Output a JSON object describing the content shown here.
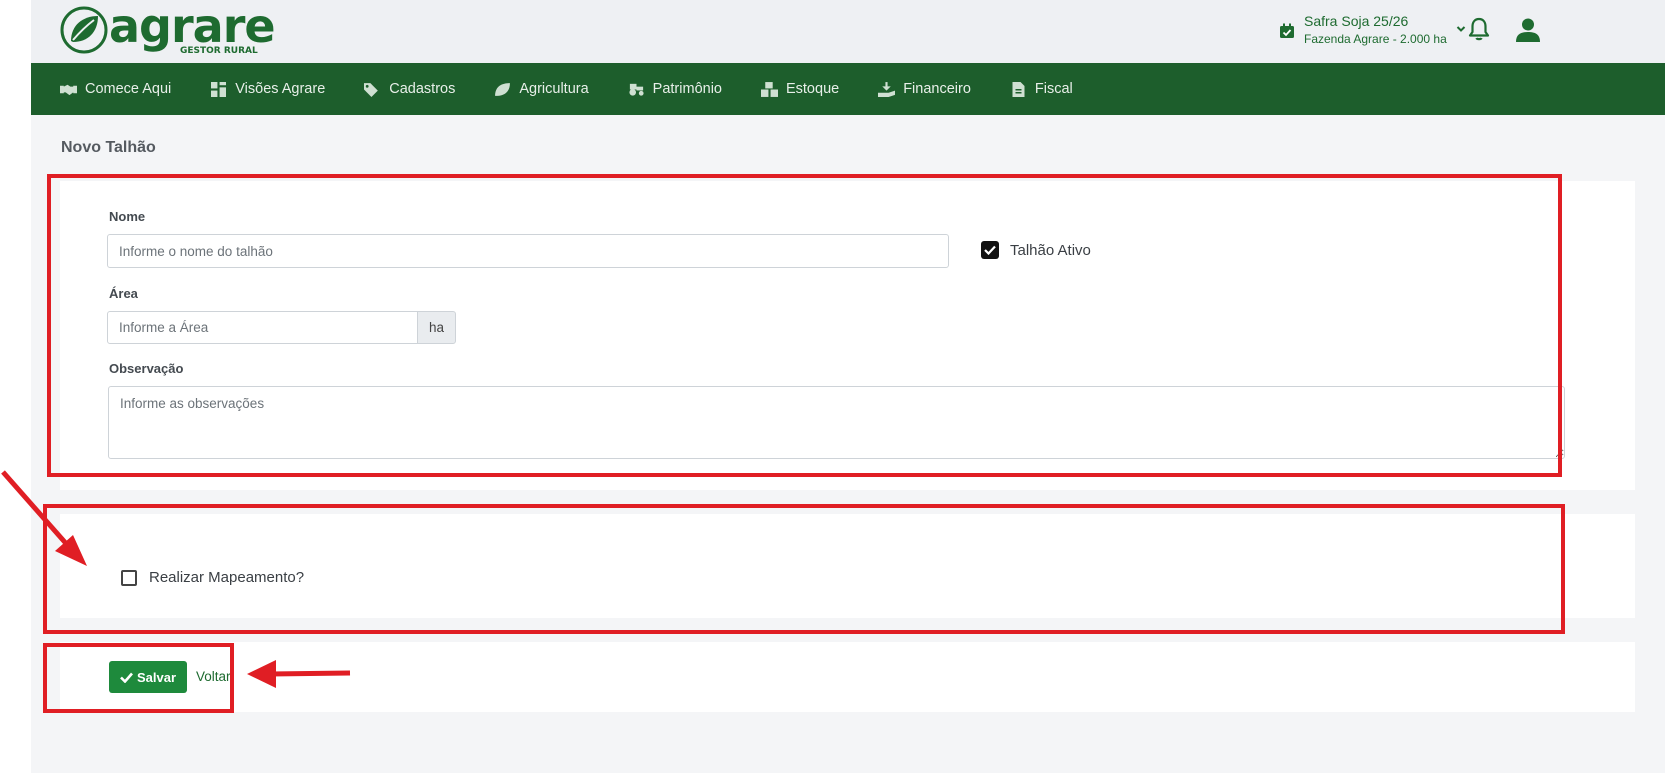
{
  "header": {
    "brand": "agrare",
    "brand_sub": "GESTOR RURAL",
    "safra_title": "Safra Soja 25/26",
    "safra_farm": "Fazenda Agrare - 2.000 ha"
  },
  "nav": {
    "items": [
      {
        "label": "Comece Aqui",
        "icon": "handshake-icon"
      },
      {
        "label": "Visões Agrare",
        "icon": "dashboard-icon"
      },
      {
        "label": "Cadastros",
        "icon": "tags-icon"
      },
      {
        "label": "Agricultura",
        "icon": "leaf-icon"
      },
      {
        "label": "Patrimônio",
        "icon": "tractor-icon"
      },
      {
        "label": "Estoque",
        "icon": "boxes-icon"
      },
      {
        "label": "Financeiro",
        "icon": "hand-coin-icon"
      },
      {
        "label": "Fiscal",
        "icon": "invoice-icon"
      }
    ]
  },
  "page": {
    "title": "Novo Talhão"
  },
  "form": {
    "nome_label": "Nome",
    "nome_placeholder": "Informe o nome do talhão",
    "ativo_label": "Talhão Ativo",
    "ativo_checked": true,
    "area_label": "Área",
    "area_placeholder": "Informe a Área",
    "area_unit": "ha",
    "obs_label": "Observação",
    "obs_placeholder": "Informe as observações",
    "mapear_label": "Realizar Mapeamento?",
    "mapear_checked": false
  },
  "actions": {
    "save_label": "Salvar",
    "back_label": "Voltar"
  },
  "colors": {
    "brand_green": "#1e6b30",
    "nav_green": "#1d5e2c",
    "save_green": "#1e8a3c",
    "annotation_red": "#e01e24"
  }
}
